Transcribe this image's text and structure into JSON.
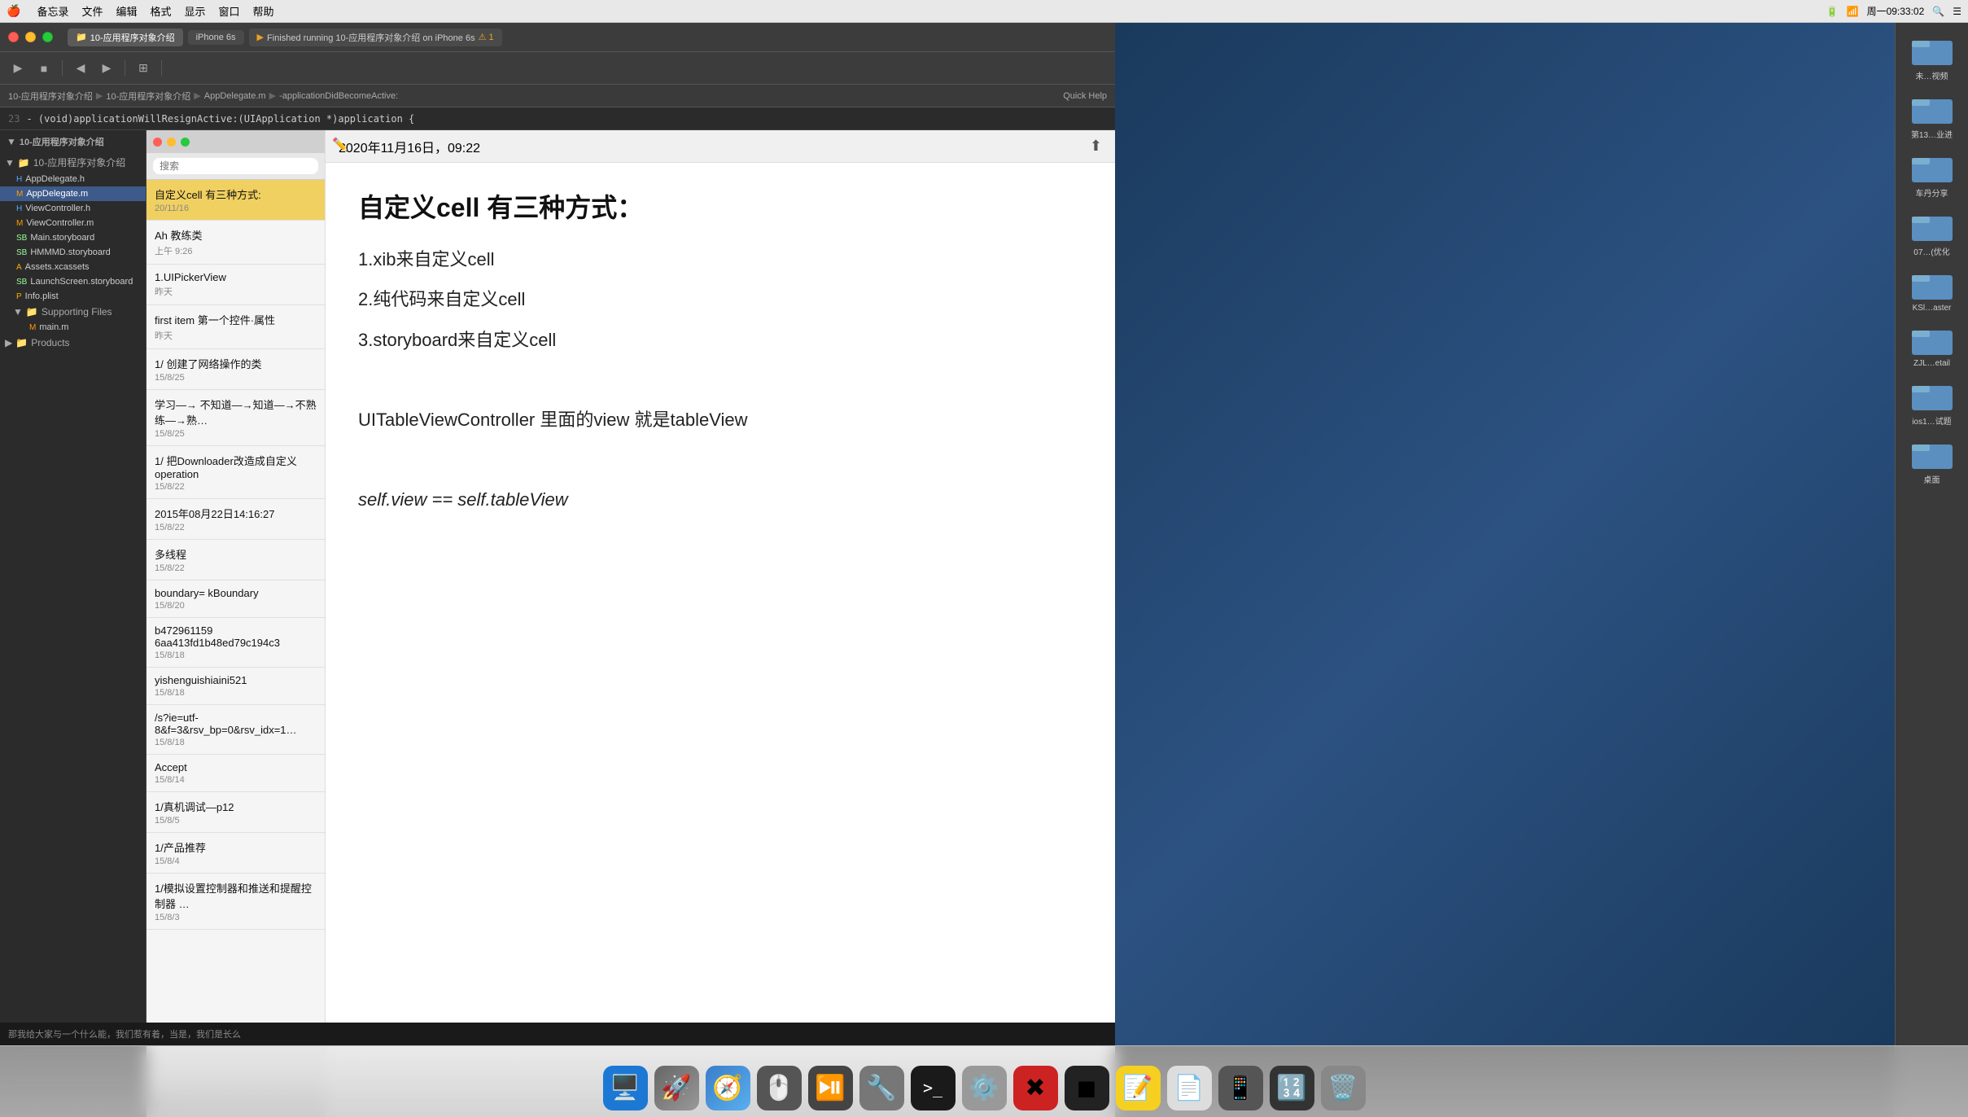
{
  "menubar": {
    "apple": "⌘",
    "items": [
      "备忘录",
      "文件",
      "编辑",
      "格式",
      "显示",
      "窗口",
      "帮助"
    ],
    "time": "周一09:33:02",
    "battery_icon": "🔋",
    "wifi_icon": "📶",
    "search_icon": "🔍"
  },
  "window": {
    "title": "10-应用程序对象介绍",
    "tab1": "10-应用程序对象介绍",
    "tab2": "iPhone 6s",
    "tab3": "Finished running 10-应用程序对象介绍 on iPhone 6s",
    "warning": "⚠ 1"
  },
  "breadcrumb": {
    "items": [
      "10-应用程序对象介绍",
      "10-应用程序对象介绍",
      "AppDelegate.m",
      "-applicationDidBecomeActive:"
    ],
    "quick_help": "Quick Help"
  },
  "code_preview": {
    "line_number": "23",
    "code": "- (void)applicationWillResignActive:(UIApplication *)application {"
  },
  "file_navigator": {
    "project_name": "10-应用程序对象介绍",
    "group": "10-应用程序对象介绍",
    "files": [
      {
        "name": "AppDelegate.h",
        "type": "h"
      },
      {
        "name": "AppDelegate.m",
        "type": "m",
        "selected": true
      },
      {
        "name": "ViewController.h",
        "type": "h"
      },
      {
        "name": "ViewController.m",
        "type": "m"
      },
      {
        "name": "Main.storyboard",
        "type": "sb"
      },
      {
        "name": "HMMMD.storyboard",
        "type": "sb"
      },
      {
        "name": "Assets.xcassets",
        "type": "assets"
      },
      {
        "name": "LaunchScreen.storyboard",
        "type": "sb"
      },
      {
        "name": "Info.plist",
        "type": "plist"
      },
      {
        "name": "Supporting Files",
        "type": "folder"
      },
      {
        "name": "main.m",
        "type": "m",
        "indent": true
      },
      {
        "name": "Products",
        "type": "folder"
      }
    ]
  },
  "notes": {
    "search_placeholder": "搜索",
    "selected_note": {
      "title": "自定义cell 有三种方式:",
      "date": "20/11/16"
    },
    "items": [
      {
        "title": "自定义cell 有三种方式:",
        "date": "20/11/16",
        "selected": true
      },
      {
        "title": "Ah  教练类",
        "date": "上午 9:26"
      },
      {
        "title": "1.UIPickerView",
        "date": "昨天"
      },
      {
        "title": "first item 第一个控件·属性",
        "date": "昨天"
      },
      {
        "title": "1/ 创建了网络操作的类",
        "date": "15/8/25"
      },
      {
        "title": "学习—→ 不知道—→知道—→不熟练—→熟…",
        "date": "15/8/25"
      },
      {
        "title": "1/ 把Downloader改造成自定义operation",
        "date": "15/8/22"
      },
      {
        "title": "2015年08月22日14:16:27",
        "date": "15/8/22"
      },
      {
        "title": "多线程",
        "date": "15/8/22"
      },
      {
        "title": "boundary= kBoundary",
        "date": "15/8/20"
      },
      {
        "title": "b472961159 6aa413fd1b48ed79c194c3",
        "date": "15/8/18"
      },
      {
        "title": "yishenguishiaini521",
        "date": "15/8/18"
      },
      {
        "title": "/s?ie=utf-8&f=3&rsv_bp=0&rsv_idx=1…",
        "date": "15/8/18"
      },
      {
        "title": "Accept",
        "date": "15/8/14"
      },
      {
        "title": "1/真机调试—p12",
        "date": "15/8/5"
      },
      {
        "title": "1/产品推荐",
        "date": "15/8/4"
      },
      {
        "title": "1/模拟设置控制器和推送和提醒控制器 …",
        "date": "15/8/3"
      }
    ]
  },
  "note_content": {
    "timestamp": "2020年11月16日，09:22",
    "title": "自定义cell 有三种方式：",
    "body_lines": [
      "1.xib来自定义cell",
      "2.纯代码来自定义cell",
      "3.storyboard来自定义cell",
      "",
      "UITableViewController 里面的view 就是tableView",
      "",
      "self.view == self.tableView"
    ]
  },
  "folders": [
    {
      "label": "未…视频",
      "color": "#4a90d9"
    },
    {
      "label": "第13…业进",
      "color": "#4a90d9"
    },
    {
      "label": "车丹分享",
      "color": "#4a90d9"
    },
    {
      "label": "07…(优化",
      "color": "#4a90d9"
    },
    {
      "label": "KSl…aster",
      "color": "#4a90d9"
    },
    {
      "label": "ZJL…etail",
      "color": "#4a90d9"
    },
    {
      "label": "ios1…试题",
      "color": "#4a90d9"
    },
    {
      "label": "桌面",
      "color": "#4a90d9"
    }
  ],
  "dock": {
    "items": [
      {
        "label": "Finder",
        "emoji": "🖥️",
        "bg": "#1c78d4"
      },
      {
        "label": "Launchpad",
        "emoji": "🚀",
        "bg": "#c0c0c0"
      },
      {
        "label": "Safari",
        "emoji": "🧭",
        "bg": "#3a7dc9"
      },
      {
        "label": "Mouse",
        "emoji": "🖱️",
        "bg": "#666"
      },
      {
        "label": "QuickTime",
        "emoji": "⏯️",
        "bg": "#555"
      },
      {
        "label": "Tools",
        "emoji": "🔧",
        "bg": "#888"
      },
      {
        "label": "Terminal",
        "emoji": ">_",
        "bg": "#1a1a1a"
      },
      {
        "label": "Preferences",
        "emoji": "⚙️",
        "bg": "#999"
      },
      {
        "label": "XMind",
        "emoji": "✖",
        "bg": "#e84040"
      },
      {
        "label": "Others",
        "emoji": "◼",
        "bg": "#222"
      },
      {
        "label": "Notes",
        "emoji": "📝",
        "bg": "#f5d020"
      },
      {
        "label": "Preview",
        "emoji": "📄",
        "bg": "#ccc"
      },
      {
        "label": "App",
        "emoji": "📱",
        "bg": "#555"
      },
      {
        "label": "Calculator",
        "emoji": "🔢",
        "bg": "#333"
      },
      {
        "label": "Trash",
        "emoji": "🗑️",
        "bg": "#777"
      }
    ]
  },
  "bottom_bar": {
    "text": "那我给大家与一个什么能，我们惹有着，当是，我们是长么"
  },
  "colors": {
    "selected_note_bg": "#f0d060",
    "accent_blue": "#3d5a8a",
    "folder_blue": "#5a8fc0",
    "toolbar_bg": "#3c3c3c",
    "sidebar_bg": "#2b2b2b"
  }
}
